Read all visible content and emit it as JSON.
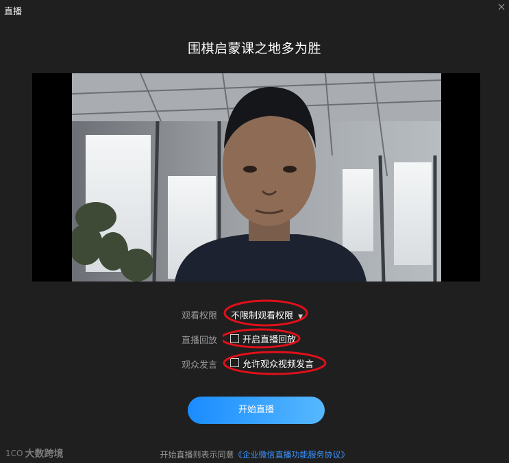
{
  "window": {
    "title": "直播"
  },
  "room": {
    "title": "围棋启蒙课之地多为胜"
  },
  "settings": {
    "view_permission": {
      "label": "观看权限",
      "value": "不限制观看权限"
    },
    "replay": {
      "label": "直播回放",
      "option": "开启直播回放",
      "checked": false
    },
    "audience_speech": {
      "label": "观众发言",
      "option": "允许观众视频发言",
      "checked": false
    }
  },
  "actions": {
    "start_label": "开始直播"
  },
  "footer": {
    "text": "开始直播则表示同意",
    "link": "《企业微信直播功能服务协议》"
  },
  "watermark": {
    "logo_text": "1CO",
    "text": "大数跨境"
  },
  "colors": {
    "accent": "#1a8cff",
    "annotation": "#e0101a",
    "background": "#1f1f1f"
  },
  "icons": {
    "close": "close-icon",
    "dropdown": "caret-down-icon"
  }
}
